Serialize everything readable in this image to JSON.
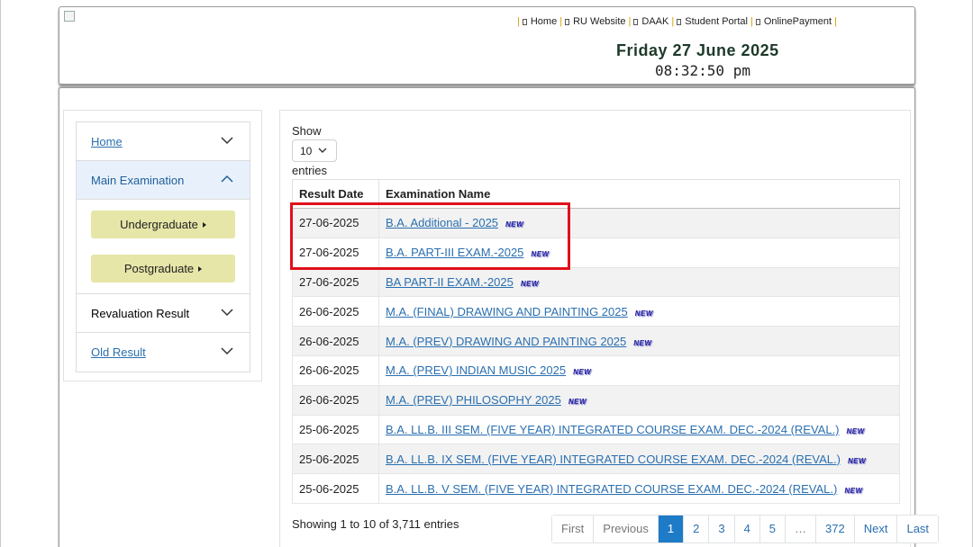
{
  "header": {
    "nav": [
      {
        "label": "Home"
      },
      {
        "label": "RU Website"
      },
      {
        "label": "DAAK"
      },
      {
        "label": "Student Portal"
      },
      {
        "label": "OnlinePayment"
      }
    ],
    "date": "Friday 27 June 2025",
    "time": "08:32:50 pm"
  },
  "sidebar": {
    "home": "Home",
    "main_exam": "Main Examination",
    "undergraduate": "Undergraduate",
    "postgraduate": "Postgraduate",
    "revaluation": "Revaluation Result",
    "old_result": "Old Result"
  },
  "table": {
    "show_label": "Show",
    "page_size": "10",
    "entries_label": "entries",
    "columns": [
      "Result Date",
      "Examination Name"
    ],
    "badge": "NEW",
    "rows": [
      {
        "date": "27-06-2025",
        "name": "B.A. Additional - 2025"
      },
      {
        "date": "27-06-2025",
        "name": "B.A. PART-III EXAM.-2025"
      },
      {
        "date": "27-06-2025",
        "name": "BA PART-II EXAM.-2025"
      },
      {
        "date": "26-06-2025",
        "name": "M.A. (FINAL) DRAWING AND PAINTING 2025"
      },
      {
        "date": "26-06-2025",
        "name": "M.A. (PREV) DRAWING AND PAINTING 2025"
      },
      {
        "date": "26-06-2025",
        "name": "M.A. (PREV) INDIAN MUSIC 2025"
      },
      {
        "date": "26-06-2025",
        "name": "M.A. (PREV) PHILOSOPHY 2025"
      },
      {
        "date": "25-06-2025",
        "name": "B.A. LL.B. III SEM. (FIVE YEAR) INTEGRATED COURSE EXAM. DEC.-2024 (REVAL.)"
      },
      {
        "date": "25-06-2025",
        "name": "B.A. LL.B. IX SEM. (FIVE YEAR) INTEGRATED COURSE EXAM. DEC.-2024 (REVAL.)"
      },
      {
        "date": "25-06-2025",
        "name": "B.A. LL.B. V SEM. (FIVE YEAR) INTEGRATED COURSE EXAM. DEC.-2024 (REVAL.)"
      }
    ],
    "info": "Showing 1 to 10 of 3,711 entries"
  },
  "pagination": {
    "first": "First",
    "previous": "Previous",
    "pages": [
      "1",
      "2",
      "3",
      "4",
      "5"
    ],
    "ellipsis": "…",
    "last_page": "372",
    "next": "Next",
    "last": "Last"
  },
  "colors": {
    "link": "#2a6fb0",
    "accent": "#1e7bc8",
    "highlight": "#e0101b",
    "submenu_button": "#e6e6a8"
  }
}
